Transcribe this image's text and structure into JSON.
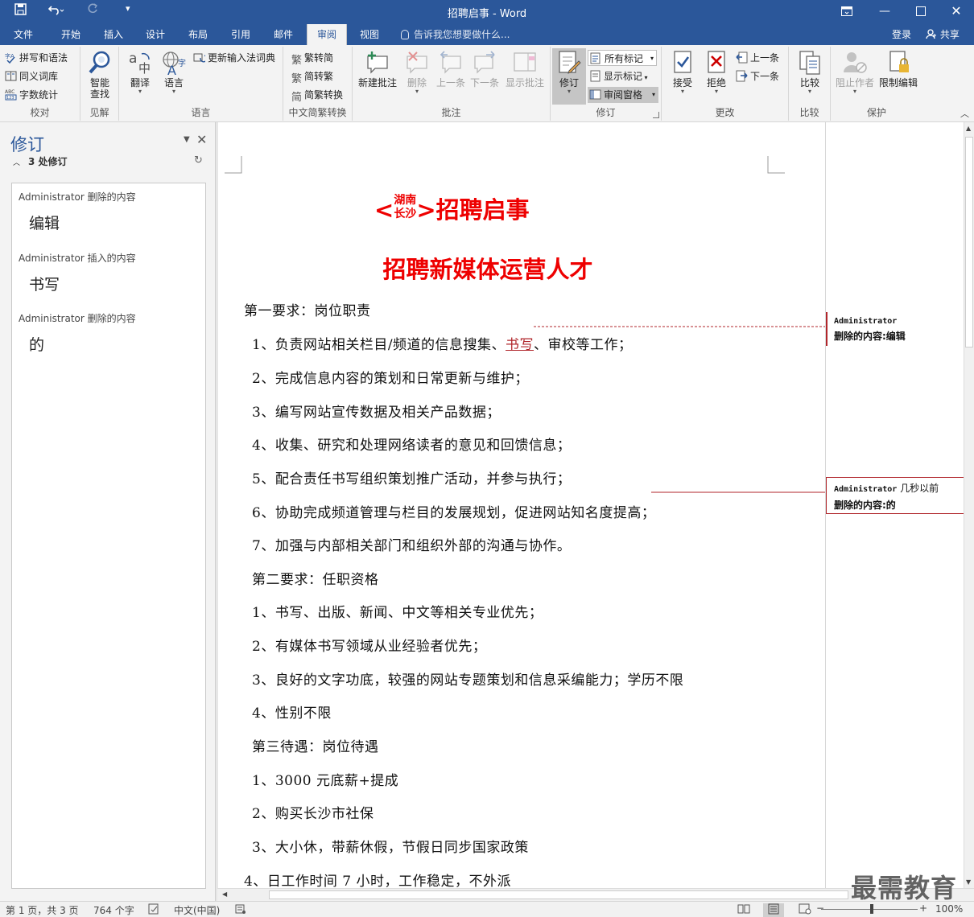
{
  "app": {
    "title": "招聘启事 - Word"
  },
  "tabs": [
    "文件",
    "开始",
    "插入",
    "设计",
    "布局",
    "引用",
    "邮件",
    "审阅",
    "视图"
  ],
  "tell_me": "告诉我您想要做什么...",
  "account": {
    "login": "登录",
    "share": "共享"
  },
  "ribbon": {
    "proofing": {
      "spelling": "拼写和语法",
      "thesaurus": "同义词库",
      "word_count": "字数统计",
      "label": "校对"
    },
    "insights": {
      "smart_lookup": "智能",
      "smart_lookup2": "查找",
      "label": "见解"
    },
    "language": {
      "translate": "翻译",
      "language": "语言",
      "update_ime": "更新输入法词典",
      "label": "语言"
    },
    "chinese": {
      "to_simplified": "繁转简",
      "to_traditional": "简转繁",
      "convert": "简繁转换",
      "label": "中文简繁转换"
    },
    "comments": {
      "new": "新建批注",
      "delete": "删除",
      "prev": "上一条",
      "next": "下一条",
      "show": "显示批注",
      "label": "批注"
    },
    "tracking": {
      "track": "修订",
      "all_markup": "所有标记",
      "show_markup": "显示标记",
      "review_pane": "审阅窗格",
      "label": "修订"
    },
    "changes": {
      "accept": "接受",
      "reject": "拒绝",
      "prev": "上一条",
      "next": "下一条",
      "label": "更改"
    },
    "compare": {
      "compare": "比较",
      "label": "比较"
    },
    "protect": {
      "block": "阻止作者",
      "restrict": "限制编辑",
      "label": "保护"
    }
  },
  "revision_pane": {
    "title": "修订",
    "count": "3 处修订",
    "items": [
      {
        "meta": "Administrator 删除的内容",
        "text": "编辑"
      },
      {
        "meta": "Administrator 插入的内容",
        "text": "书写"
      },
      {
        "meta": "Administrator 删除的内容",
        "text": "的"
      }
    ]
  },
  "document": {
    "heading1_left": "湖南",
    "heading1_right": "长沙",
    "heading1_open": "<",
    "heading1_close": ">",
    "heading1_main": "招聘启事",
    "heading2": "招聘新媒体运营人才",
    "line1": "第一要求：岗位职责",
    "line2a": "1、负责网站相关栏目/频道的信息搜集、",
    "line2ins": "书写",
    "line2b": "、审校等工作；",
    "line3": "2、完成信息内容的策划和日常更新与维护；",
    "line4": "3、编写网站宣传数据及相关产品数据；",
    "line5": "4、收集、研究和处理网络读者的意见和回馈信息；",
    "line6": "5、配合责任书写组织策划推广活动，并参与执行；",
    "line7": "6、协助完成频道管理与栏目的发展规划，促进网站知名度提高；",
    "line8": "7、加强与内部相关部门和组织外部的沟通与协作。",
    "line9": "第二要求：任职资格",
    "line10": "1、书写、出版、新闻、中文等相关专业优先；",
    "line11": "2、有媒体书写领域从业经验者优先；",
    "line12": "3、良好的文字功底，较强的网站专题策划和信息采编能力；学历不限",
    "line13": "4、性别不限",
    "line14": "第三待遇：岗位待遇",
    "line15": "1、3000 元底薪+提成",
    "line16": "2、购买长沙市社保",
    "line17": "3、大小休，带薪休假，节假日同步国家政策",
    "line18": "4、日工作时间 7 小时，工作稳定，不外派"
  },
  "balloons": [
    {
      "who": "Administrator",
      "extra": "",
      "what": "删除的内容:编辑"
    },
    {
      "who": "Administrator",
      "extra": "几秒以前",
      "what": "删除的内容:的"
    }
  ],
  "status": {
    "page": "第 1 页，共 3 页",
    "words": "764 个字",
    "lang": "中文(中国)",
    "zoom": "100%",
    "zoom_fraction": 0.5
  },
  "watermark": "最需教育",
  "colors": {
    "accent": "#2b579a",
    "heading": "#e00000",
    "revision": "#b0262b"
  }
}
